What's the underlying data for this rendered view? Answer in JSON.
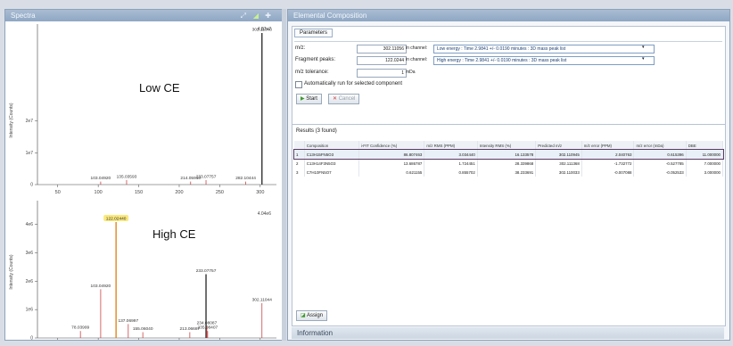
{
  "spectrum_panel": {
    "title": "Spectra",
    "toolbar_icons": [
      "zoom-icon",
      "color-icon",
      "pin-icon"
    ],
    "low": {
      "annotation": "Low CE",
      "y_label": "Intensity (Counts)",
      "y_scale_label": "4.87e7",
      "y_ticks": [
        "0",
        "1e7",
        "2e7"
      ],
      "x_ticks": [
        "50",
        "100",
        "150",
        "200",
        "250",
        "300"
      ],
      "peaks": [
        {
          "mz": 103.0492,
          "rel": 0.02,
          "label": "103.04920"
        },
        {
          "mz": 135.03593,
          "rel": 0.03,
          "label": "135.03593"
        },
        {
          "mz": 214.0591,
          "rel": 0.02,
          "label": "214.05910"
        },
        {
          "mz": 233.07757,
          "rel": 0.03,
          "label": "233.07757"
        },
        {
          "mz": 282.10444,
          "rel": 0.02,
          "label": "282.10444"
        },
        {
          "mz": 302.11048,
          "rel": 1.0,
          "label": "302.11048"
        }
      ]
    },
    "high": {
      "annotation": "High CE",
      "y_label": "Intensity (Counts)",
      "y_scale_label": "4.04e6",
      "y_ticks": [
        "0",
        "1e6",
        "2e6",
        "3e6",
        "4e6"
      ],
      "x_ticks": [
        "50",
        "100",
        "150",
        "200",
        "250",
        "300"
      ],
      "peaks": [
        {
          "mz": 78.03999,
          "rel": 0.06,
          "label": "78.03999"
        },
        {
          "mz": 103.0492,
          "rel": 0.42,
          "label": "103.04920"
        },
        {
          "mz": 122.0244,
          "rel": 1.0,
          "label": "122.02440",
          "highlight": true
        },
        {
          "mz": 137.06997,
          "rel": 0.12,
          "label": "137.06997"
        },
        {
          "mz": 155.0604,
          "rel": 0.05,
          "label": "155.06040"
        },
        {
          "mz": 213.06687,
          "rel": 0.05,
          "label": "213.06687"
        },
        {
          "mz": 233.07757,
          "rel": 0.55,
          "label": "233.07757"
        },
        {
          "mz": 234.08087,
          "rel": 0.1,
          "label": "234.08087"
        },
        {
          "mz": 235.08407,
          "rel": 0.06,
          "label": "235.08407"
        },
        {
          "mz": 302.11044,
          "rel": 0.3,
          "label": "302.11044"
        }
      ]
    }
  },
  "elemental": {
    "title": "Elemental Composition",
    "tab": "Parameters",
    "mz_label": "m/z:",
    "mz_value": "302.11056",
    "in_channel_1": "in channel:",
    "channel_1": "Low energy : Time 2.9841 +/- 0.0190 minutes : 3D mass peak list",
    "fragment_label": "Fragment peaks:",
    "fragment_value": "122.0244",
    "in_channel_2": "in channel:",
    "channel_2": "High energy : Time 2.9841 +/- 0.0190 minutes : 3D mass peak list",
    "tolerance_label": "m/z tolerance:",
    "tolerance_value": "1",
    "tolerance_unit": "mDa",
    "auto_run_label": "Automatically run for selected component",
    "start_label": "Start",
    "cancel_label": "Cancel",
    "results_title": "Results (3 found)",
    "columns": [
      "",
      "Composition",
      "i-FIT Confidence (%)",
      "m/z RMS (PPM)",
      "Intensity RMS (%)",
      "Predicted m/z",
      "m/z error (PPM)",
      "m/z error (mDa)",
      "DBE"
    ],
    "rows": [
      [
        "1",
        "C13H15FN5O3",
        "86.807463",
        "3.034440",
        "16.133578",
        "302.110945",
        "2.040763",
        "0.615396",
        "11.000000"
      ],
      [
        "2",
        "C13H14F3N5O3",
        "13.686787",
        "1.724451",
        "28.339868",
        "302.111368",
        "-1.732772",
        "-0.527785",
        "7.000000"
      ],
      [
        "3",
        "C7H10FN5O7",
        "0.621155",
        "0.855702",
        "38.233691",
        "302.110033",
        "-0.007088",
        "-0.052533",
        "3.000000"
      ]
    ],
    "assign_label": "Assign",
    "info_title": "Information"
  }
}
